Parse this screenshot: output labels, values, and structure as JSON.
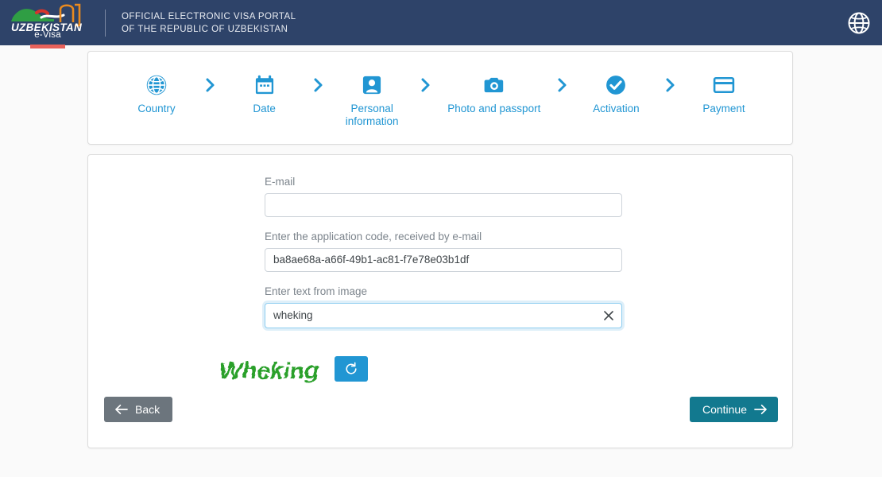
{
  "header": {
    "logo": {
      "country_name": "UZBEKISTAN",
      "sub_label": "e-Visa",
      "icon": "uzbekistan-evisa-logo"
    },
    "title_line1": "OFFICIAL ELECTRONIC VISA PORTAL",
    "title_line2": "OF THE REPUBLIC OF UZBEKISTAN",
    "language_icon": "globe-icon",
    "background_color": "#2e4369",
    "accent_color": "#e8615a"
  },
  "stepper": {
    "active_color": "#2196d3",
    "separator_icon": "chevron-right-icon",
    "steps": [
      {
        "label": "Country",
        "icon": "globe-icon"
      },
      {
        "label": "Date",
        "icon": "calendar-icon"
      },
      {
        "label": "Personal\ninformation",
        "icon": "person-card-icon"
      },
      {
        "label": "Photo and passport",
        "icon": "camera-icon"
      },
      {
        "label": "Activation",
        "icon": "check-circle-icon"
      },
      {
        "label": "Payment",
        "icon": "credit-card-icon"
      }
    ]
  },
  "form": {
    "email": {
      "label": "E-mail",
      "value": "",
      "placeholder": ""
    },
    "application_code": {
      "label": "Enter the application code, received by e-mail",
      "value": "ba8ae68a-a66f-49b1-ac81-f7e78e03b1df",
      "placeholder": ""
    },
    "captcha_input": {
      "label": "Enter text from image",
      "value": "wheking",
      "placeholder": "",
      "clear_icon": "close-icon",
      "focused": true
    },
    "captcha": {
      "text": "Wheking",
      "text_color": "#2aa02a",
      "refresh_icon": "refresh-icon",
      "refresh_color": "#2196d3"
    }
  },
  "actions": {
    "back": {
      "label": "Back",
      "icon": "arrow-left-icon",
      "color": "#6c757d"
    },
    "continue": {
      "label": "Continue",
      "icon": "arrow-right-icon",
      "color": "#12798f"
    }
  }
}
